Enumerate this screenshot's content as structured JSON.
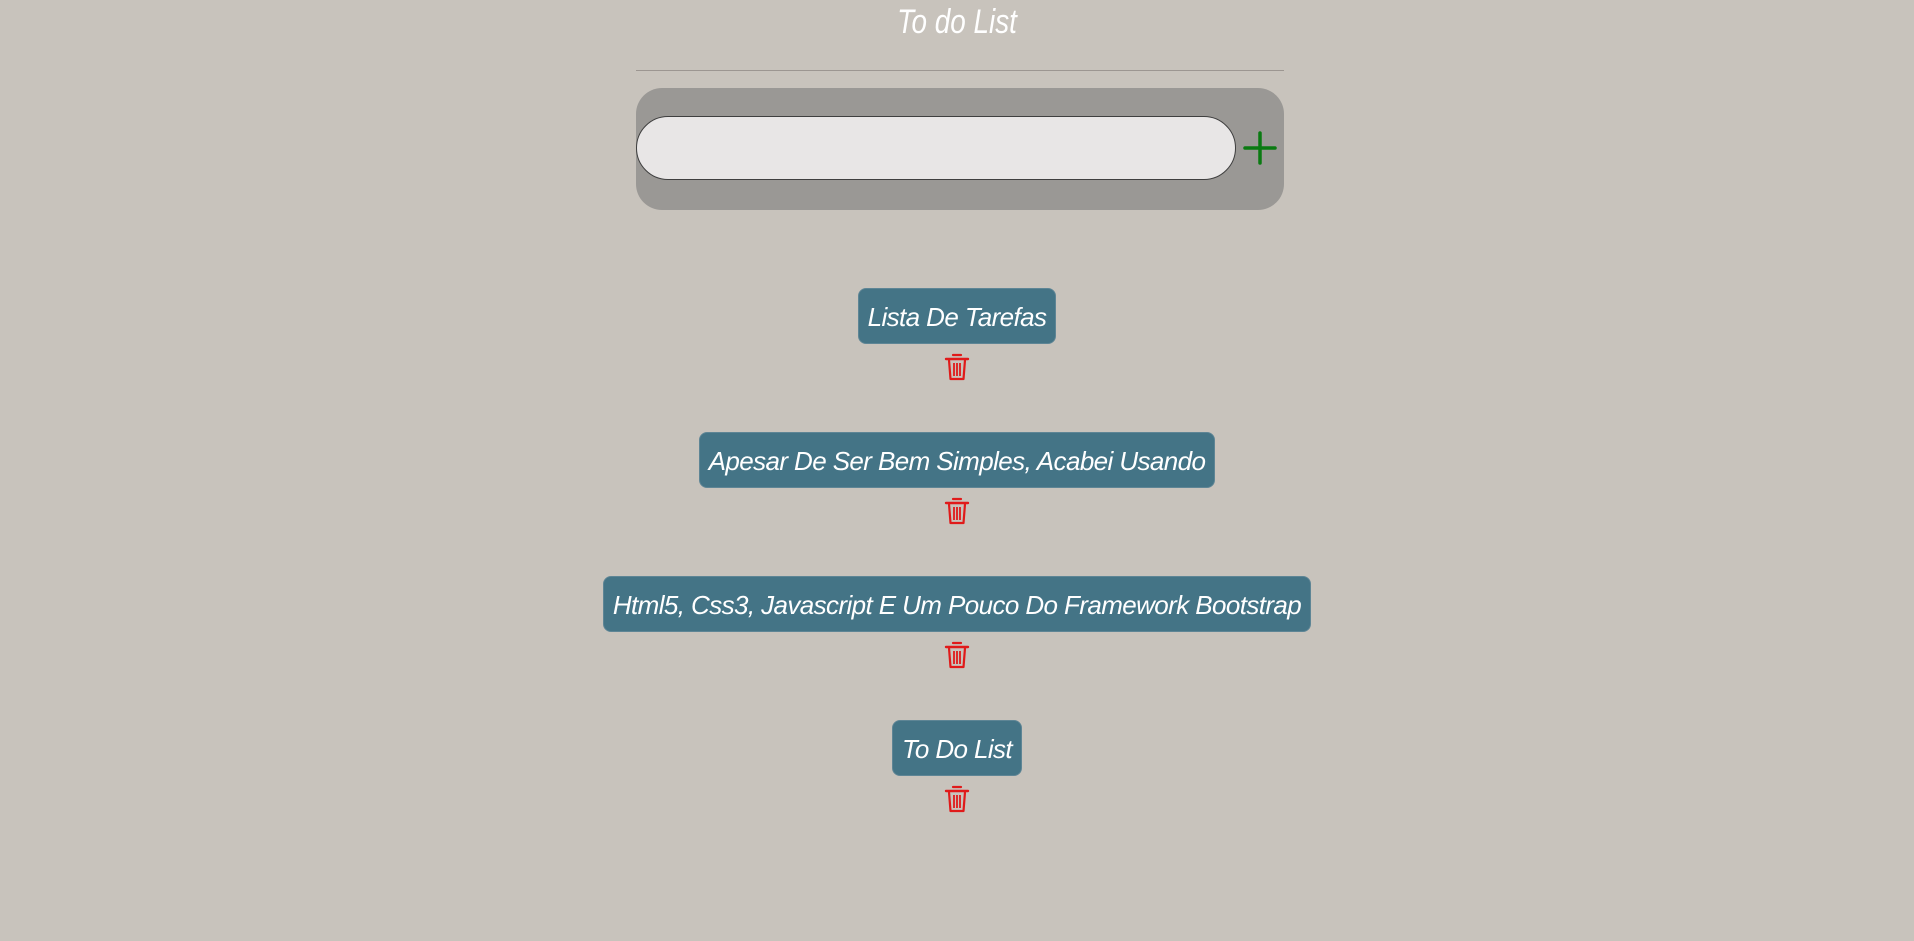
{
  "app": {
    "title": "To do List"
  },
  "input": {
    "value": "",
    "placeholder": ""
  },
  "icons": {
    "add": "plus-icon",
    "delete": "trash-icon"
  },
  "colors": {
    "background": "#c8c3bc",
    "panel": "#9a9895",
    "task_badge": "#447486",
    "add_icon": "#0a7a12",
    "delete_icon": "#e01a1a"
  },
  "tasks": [
    {
      "label": "Lista De Tarefas"
    },
    {
      "label": "Apesar De Ser Bem Simples, Acabei Usando"
    },
    {
      "label": "Html5, Css3, Javascript E Um Pouco Do Framework Bootstrap"
    },
    {
      "label": "To Do List"
    }
  ]
}
